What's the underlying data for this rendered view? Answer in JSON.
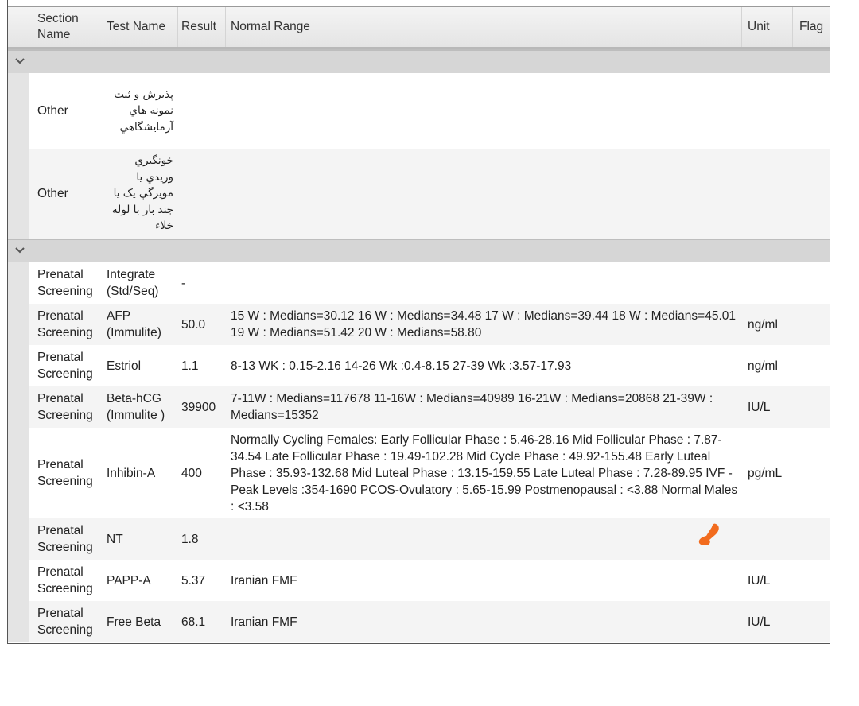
{
  "columns": {
    "section_name": "Section Name",
    "test_name": "Test Name",
    "result": "Result",
    "normal_range": "Normal Range",
    "unit": "Unit",
    "flag": "Flag"
  },
  "groups": [
    {
      "icon": "chevron-down-icon",
      "rows": [
        {
          "section": "Other",
          "test": "پذيرش و ثبت نمونه هاي آزمايشگاهي",
          "result": "",
          "range": "",
          "unit": "",
          "flag": ""
        },
        {
          "section": "Other",
          "test": "خونگيري وريدي يا مويرگي يک يا چند بار با لوله خلاء",
          "result": "",
          "range": "",
          "unit": "",
          "flag": ""
        }
      ]
    },
    {
      "icon": "chevron-down-icon",
      "rows": [
        {
          "section": "Prenatal Screening",
          "test": "Integrate (Std/Seq)",
          "result": "-",
          "range": "",
          "unit": "",
          "flag": ""
        },
        {
          "section": "Prenatal Screening",
          "test": "AFP (Immulite)",
          "result": "50.0",
          "range": "15 W : Medians=30.12 16 W : Medians=34.48 17 W : Medians=39.44 18 W : Medians=45.01 19 W : Medians=51.42 20 W : Medians=58.80",
          "unit": "ng/ml",
          "flag": ""
        },
        {
          "section": "Prenatal Screening",
          "test": "Estriol",
          "result": "1.1",
          "range": "8-13 WK : 0.15-2.16 14-26 Wk :0.4-8.15 27-39 Wk :3.57-17.93",
          "unit": "ng/ml",
          "flag": ""
        },
        {
          "section": "Prenatal Screening",
          "test": "Beta-hCG (Immulite )",
          "result": "39900",
          "range": "7-11W : Medians=117678 11-16W : Medians=40989 16-21W : Medians=20868 21-39W : Medians=15352",
          "unit": "IU/L",
          "flag": ""
        },
        {
          "section": "Prenatal Screening",
          "test": "Inhibin-A",
          "result": "400",
          "range": "Normally Cycling Females: Early Follicular Phase : 5.46-28.16 Mid Follicular Phase : 7.87-34.54 Late Follicular Phase : 19.49-102.28 Mid Cycle Phase : 49.92-155.48 Early Luteal Phase : 35.93-132.68 Mid Luteal Phase : 13.15-159.55 Late Luteal Phase : 7.28-89.95 IVF - Peak Levels :354-1690 PCOS-Ovulatory : 5.65-15.99 Postmenopausal : <3.88 Normal Males : <3.58",
          "unit": "pg/mL",
          "flag": ""
        },
        {
          "section": "Prenatal Screening",
          "test": "NT",
          "result": "1.8",
          "range": "",
          "unit": "",
          "flag": ""
        },
        {
          "section": "Prenatal Screening",
          "test": "PAPP-A",
          "result": "5.37",
          "range": "Iranian FMF",
          "unit": "IU/L",
          "flag": ""
        },
        {
          "section": "Prenatal Screening",
          "test": "Free Beta",
          "result": "68.1",
          "range": "Iranian FMF",
          "unit": "IU/L",
          "flag": ""
        }
      ]
    }
  ],
  "colors": {
    "header_bg": "#e8e8e8",
    "group_bg": "#d6d6d6",
    "row_alt": "#f4f4f4",
    "annotation": "#f26b1d"
  }
}
